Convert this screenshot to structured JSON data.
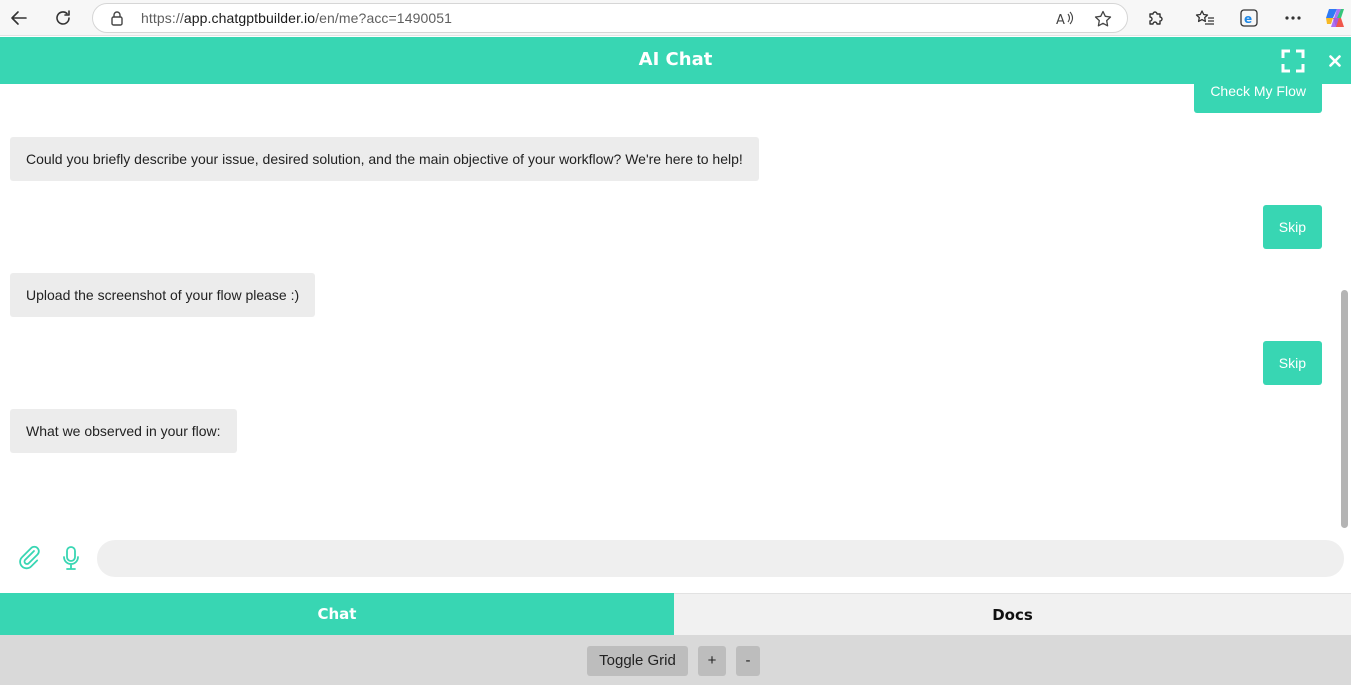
{
  "browser": {
    "url_prefix": "https://",
    "url_host": "app.chatgptbuilder.io",
    "url_path": "/en/me?acc=1490051"
  },
  "header": {
    "title": "AI Chat"
  },
  "messages": [
    {
      "role": "user",
      "text": "Check My Flow"
    },
    {
      "role": "bot",
      "text": "Could you briefly describe your issue, desired solution, and the main objective of your workflow? We're here to help!"
    },
    {
      "role": "user",
      "text": "Skip"
    },
    {
      "role": "bot",
      "text": "Upload the screenshot of your flow please :)"
    },
    {
      "role": "user",
      "text": "Skip"
    },
    {
      "role": "bot",
      "text": "What we observed in your flow:"
    }
  ],
  "input": {
    "placeholder": "",
    "value": ""
  },
  "tabs": [
    {
      "label": "Chat",
      "active": true
    },
    {
      "label": "Docs",
      "active": false
    }
  ],
  "toolbar": {
    "toggle_grid_label": "Toggle Grid",
    "zoom_in_label": "+",
    "zoom_out_label": "-"
  },
  "colors": {
    "accent": "#38d6b3",
    "bot_bubble": "#ececec"
  },
  "icons": {
    "back": "back-arrow-icon",
    "reload": "reload-icon",
    "lock": "lock-icon",
    "read_aloud": "read-aloud-icon",
    "favorite": "star-icon",
    "extensions": "puzzle-icon",
    "favorites": "favorites-list-icon",
    "edge": "edge-icon",
    "more": "more-dots-icon",
    "copilot": "copilot-icon",
    "fullscreen": "fullscreen-icon",
    "close": "close-icon",
    "attach": "paperclip-icon",
    "mic": "microphone-icon"
  }
}
